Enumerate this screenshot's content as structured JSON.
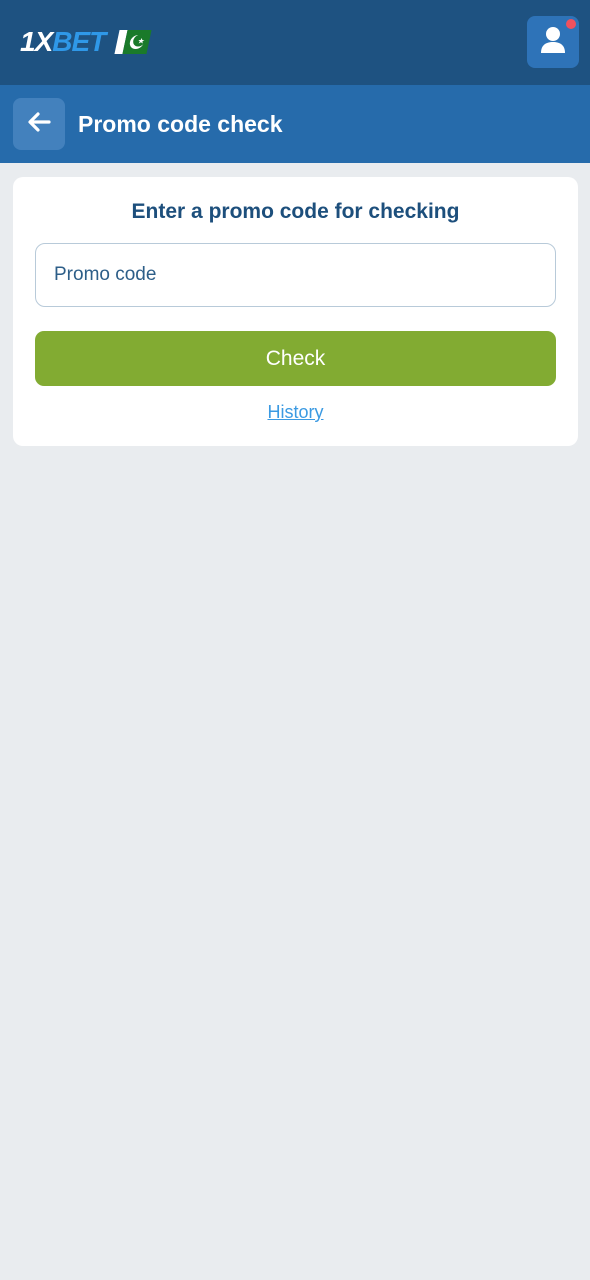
{
  "brand": {
    "logo_part1": "1X",
    "logo_part2": "BET"
  },
  "header": {
    "title": "Promo code check"
  },
  "card": {
    "heading": "Enter a promo code for checking",
    "input_placeholder": "Promo code",
    "input_value": "",
    "check_label": "Check",
    "history_label": "History"
  },
  "icons": {
    "user": "user-icon",
    "back": "arrow-left-icon",
    "flag": "pakistan-flag-icon",
    "notification": "notification-dot"
  },
  "colors": {
    "topbar": "#1e5281",
    "subheader": "#266bab",
    "check_button": "#82ab32",
    "link": "#3b9ae2",
    "notification_dot": "#f0515e"
  }
}
